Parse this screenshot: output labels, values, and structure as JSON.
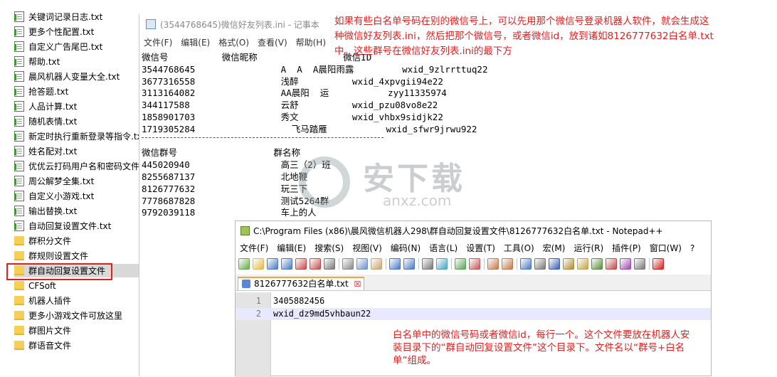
{
  "explorer": {
    "items": [
      {
        "label": "关键词记录日志.txt",
        "type": "file"
      },
      {
        "label": "更多个性配置.txt",
        "type": "file"
      },
      {
        "label": "自定义广告尾巴.txt",
        "type": "file"
      },
      {
        "label": "帮助.txt",
        "type": "file"
      },
      {
        "label": "晨风机器人变量大全.txt",
        "type": "file"
      },
      {
        "label": "抢答题.txt",
        "type": "file"
      },
      {
        "label": "人品计算.txt",
        "type": "file"
      },
      {
        "label": "随机表情.txt",
        "type": "file"
      },
      {
        "label": "新定时执行重新登录等指令.txt",
        "type": "file"
      },
      {
        "label": "姓名配对.txt",
        "type": "file"
      },
      {
        "label": "优优云打码用户名和密码文件",
        "type": "file"
      },
      {
        "label": "周公解梦全集.txt",
        "type": "file"
      },
      {
        "label": "自定义小游戏.txt",
        "type": "file"
      },
      {
        "label": "输出替换.txt",
        "type": "file"
      },
      {
        "label": "自动回复设置文件.txt",
        "type": "file"
      },
      {
        "label": "群积分文件",
        "type": "folder"
      },
      {
        "label": "群规则设置文件",
        "type": "folder"
      },
      {
        "label": "群自动回复设置文件",
        "type": "folder"
      },
      {
        "label": "CFSoft",
        "type": "folder"
      },
      {
        "label": "机器人插件",
        "type": "folder"
      },
      {
        "label": "更多小游戏文件可放这里",
        "type": "folder"
      },
      {
        "label": "群图片文件",
        "type": "folder"
      },
      {
        "label": "群语音文件",
        "type": "folder"
      }
    ]
  },
  "notepad": {
    "title": "(3544768645)微信好友列表.ini - 记事本",
    "menu": [
      "文件(F)",
      "编辑(E)",
      "格式(O)",
      "查看(V)",
      "帮助(H)"
    ],
    "rows": [
      "微信号          微信昵称                微信ID",
      "3544768645                A  A  A晨阳雨露         wxid_9zlrrttuq22",
      "3677316558                浅醉          wxid_4xpvgii94e22",
      "3113164082                AA晨阳  运           zyy11335974",
      "344117588                 云舒          wxid_pzu08vo8e22",
      "1858901703                秀文          wxid_vhbx9sidjk22",
      "1719305284                  飞马踏雁           wxid_sfwr9jrwu922",
      "",
      "微信群号                  群名称",
      "445020940                 高三（2）班",
      "8255687137                北地鞭",
      "8126777632                玩三下",
      "7778687828                测试5264群",
      "9792039118                车上的人"
    ]
  },
  "note_top": "如果有些白名单号码在别的微信号上，可以先用那个微信号登录机器人软件，就会生成这种微信好友列表.ini，然后把那个微信号，或者微信id，放到诸如8126777632白名单.txt中。这些群号在微信好友列表.ini的最下方",
  "watermark": {
    "main": "安下载",
    "sub": "anxz.com"
  },
  "npp": {
    "title": "C:\\Program Files (x86)\\晨风微信机器人298\\群自动回复设置文件\\8126777632白名单.txt - Notepad++",
    "menu": [
      "文件(F)",
      "编辑(E)",
      "搜索(S)",
      "视图(V)",
      "编码(N)",
      "语言(L)",
      "设置(T)",
      "工具(O)",
      "宏(M)",
      "运行(R)",
      "插件(P)",
      "窗口(W)",
      "?"
    ],
    "tab_label": "8126777632白名单.txt",
    "tab_close": "☒",
    "lines": [
      {
        "num": "1",
        "text": "3405882456"
      },
      {
        "num": "2",
        "text": "wxid_dz9md5vhbaun22"
      }
    ]
  },
  "note_bottom": "白名单中的微信号码或者微信id，每行一个。这个文件要放在机器人安装目录下的“群自动回复设置文件”这个目录下。文件名以“群号+白名单”组成。",
  "colors": {
    "annotation": "#e02020",
    "highlight_border": "#e02020"
  }
}
